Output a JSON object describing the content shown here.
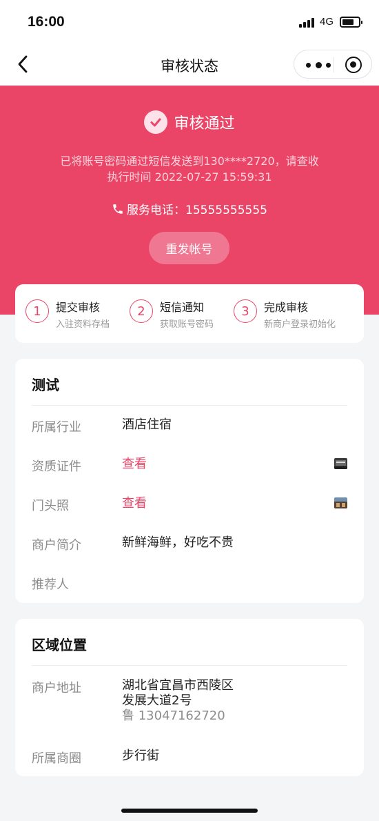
{
  "status_bar": {
    "time": "16:00",
    "network": "4G",
    "battery_level": 0.72
  },
  "nav": {
    "title": "审核状态",
    "more_icon": "more-dots-icon",
    "close_icon": "mini-program-close-icon",
    "back_icon": "chevron-left-icon"
  },
  "banner": {
    "status_text": "审核通过",
    "message": "已将账号密码通过短信发送到130****2720，请查收",
    "exec_time": "执行时间 2022-07-27 15:59:31",
    "phone_label": "服务电话：15555555555",
    "resend_label": "重发帐号",
    "color": "#ea4467"
  },
  "steps": [
    {
      "num": "1",
      "title": "提交审核",
      "sub": "入驻资料存档"
    },
    {
      "num": "2",
      "title": "短信通知",
      "sub": "获取账号密码"
    },
    {
      "num": "3",
      "title": "完成审核",
      "sub": "新商户登录初始化"
    }
  ],
  "info_card": {
    "title": "测试",
    "rows": [
      {
        "label": "所属行业",
        "value": "酒店住宿"
      },
      {
        "label": "资质证件",
        "value": "查看"
      },
      {
        "label": "门头照",
        "value": "查看"
      },
      {
        "label": "商户简介",
        "value": "新鲜海鲜，好吃不贵"
      },
      {
        "label": "推荐人",
        "value": ""
      }
    ]
  },
  "area_card": {
    "title": "区域位置",
    "address_label": "商户地址",
    "address_line1": "湖北省宜昌市西陵区",
    "address_line2": "发展大道2号",
    "address_contact": "鲁 13047162720",
    "district_label": "所属商圈",
    "district_value": "步行街"
  }
}
